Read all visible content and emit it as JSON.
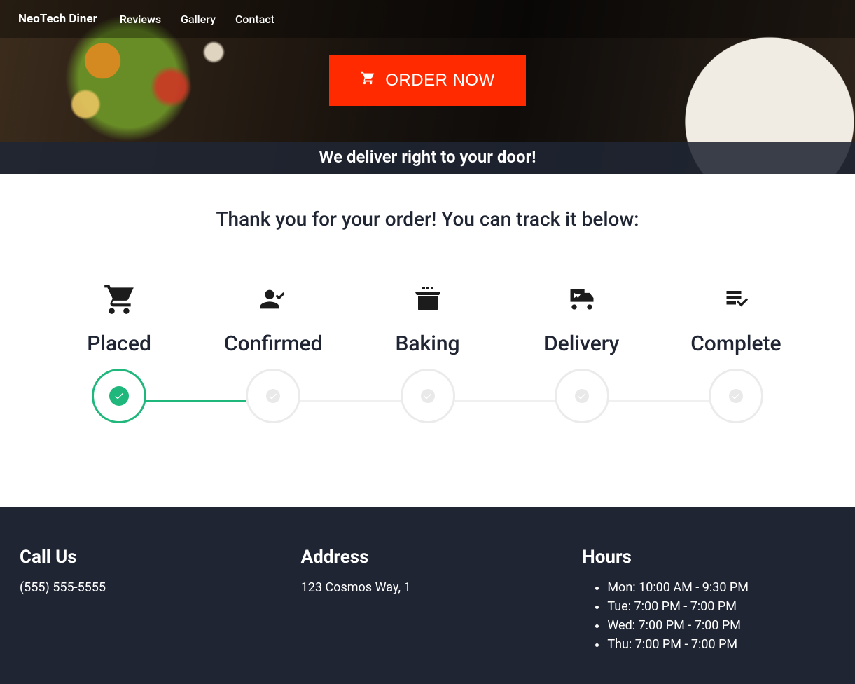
{
  "nav": {
    "brand": "NeoTech Diner",
    "links": [
      "Reviews",
      "Gallery",
      "Contact"
    ]
  },
  "hero": {
    "order_button": "ORDER NOW",
    "deliver_text": "We deliver right to your door!"
  },
  "main": {
    "thankyou": "Thank you for your order! You can track it below:",
    "steps": [
      {
        "label": "Placed",
        "active": true
      },
      {
        "label": "Confirmed",
        "active": false
      },
      {
        "label": "Baking",
        "active": false
      },
      {
        "label": "Delivery",
        "active": false
      },
      {
        "label": "Complete",
        "active": false
      }
    ]
  },
  "footer": {
    "call_title": "Call Us",
    "phone": "(555) 555-5555",
    "address_title": "Address",
    "address": "123 Cosmos Way, 1",
    "hours_title": "Hours",
    "hours": [
      "Mon: 10:00 AM - 9:30 PM",
      "Tue: 7:00 PM - 7:00 PM",
      "Wed: 7:00 PM - 7:00 PM",
      "Thu: 7:00 PM - 7:00 PM"
    ]
  },
  "colors": {
    "accent_order": "#ff2a00",
    "progress_green": "#1fb77b",
    "footer_bg": "#1f2533"
  }
}
